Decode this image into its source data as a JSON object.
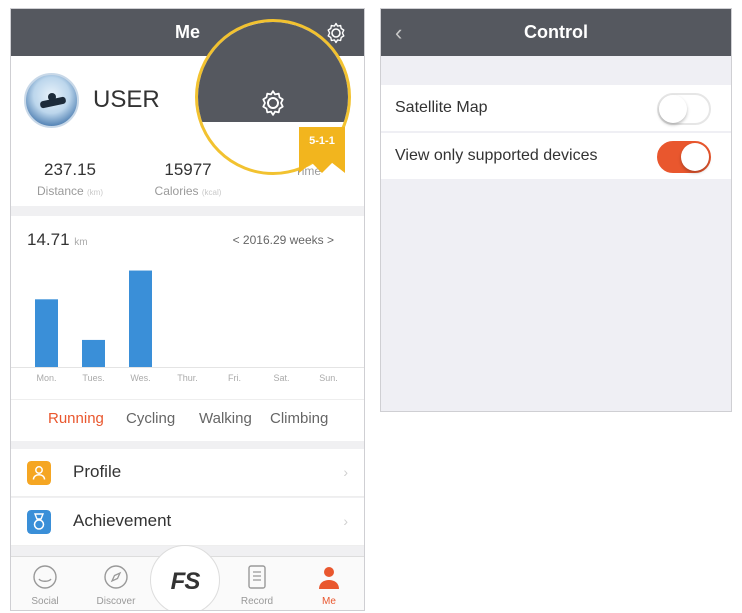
{
  "me_screen": {
    "title": "Me",
    "user": {
      "name": "USER"
    },
    "stats": [
      {
        "value": "237.15",
        "label": "Distance",
        "unit": "(km)"
      },
      {
        "value": "15977",
        "label": "Calories",
        "unit": "(kcal)"
      },
      {
        "value": "",
        "label": "Time",
        "unit": ""
      }
    ],
    "zoom_badge": "5-1-1",
    "chart": {
      "total_value": "14.71",
      "total_unit": "km",
      "week_label": "< 2016.29 weeks >"
    },
    "tabs": [
      "Running",
      "Cycling",
      "Walking",
      "Climbing"
    ],
    "active_tab": "Running",
    "menu": [
      {
        "label": "Profile",
        "icon": "person-icon",
        "color": "#f5a623"
      },
      {
        "label": "Achievement",
        "icon": "medal-icon",
        "color": "#3a8fd8"
      }
    ],
    "tab_bar": [
      {
        "label": "Social",
        "icon": "social-icon"
      },
      {
        "label": "Discover",
        "icon": "compass-icon"
      },
      {
        "label": "Record",
        "icon": "record-icon"
      },
      {
        "label": "Me",
        "icon": "person-icon"
      }
    ],
    "center_logo": "FS",
    "colors": {
      "accent": "#e9572e",
      "bar": "#3a8fd8",
      "nav": "#55585f",
      "badge": "#f2b51e"
    }
  },
  "chart_data": {
    "type": "bar",
    "categories": [
      "Mon.",
      "Tues.",
      "Wes.",
      "Thur.",
      "Fri.",
      "Sat.",
      "Sun."
    ],
    "values": [
      4.0,
      1.6,
      5.7,
      0,
      0,
      0,
      0
    ],
    "ylim": [
      0,
      6.5
    ]
  },
  "control_screen": {
    "title": "Control",
    "settings": [
      {
        "label": "Satellite Map",
        "enabled": false
      },
      {
        "label": "View only supported devices",
        "enabled": true
      }
    ]
  }
}
